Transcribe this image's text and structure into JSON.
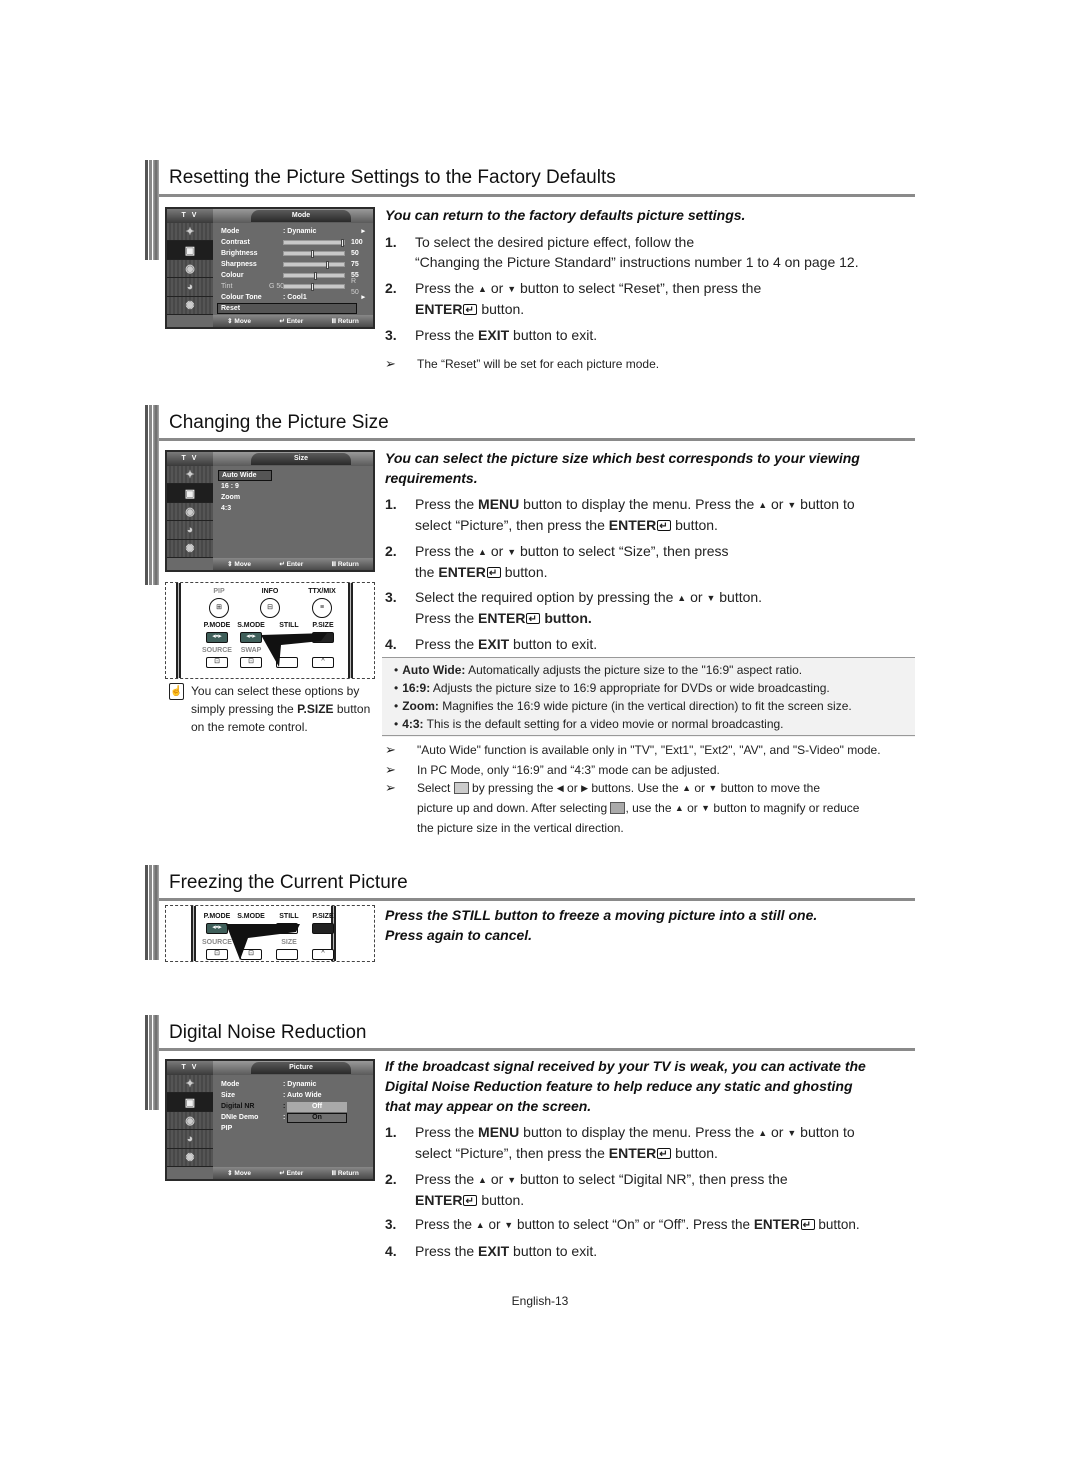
{
  "page": {
    "footer": "English-13"
  },
  "symbols": {
    "up": "▲",
    "down": "▼",
    "left": "◀",
    "right": "▶",
    "arrow_note": "➢"
  },
  "reset": {
    "title": "Resetting the Picture Settings to the Factory Defaults",
    "osd": {
      "tv": "T V",
      "tab": "Mode",
      "rows": [
        {
          "label": "Mode",
          "value": ": Dynamic",
          "arrow": "▸"
        },
        {
          "label": "Contrast",
          "slider": 100,
          "num": "100"
        },
        {
          "label": "Brightness",
          "slider": 50,
          "num": "50"
        },
        {
          "label": "Sharpness",
          "slider": 75,
          "num": "75"
        },
        {
          "label": "Colour",
          "slider": 55,
          "num": "55"
        },
        {
          "label": "Tint",
          "left": "G 50",
          "right": "R 50",
          "slider": 50
        },
        {
          "label": "Colour Tone",
          "value": ": Cool1",
          "arrow": "▸"
        },
        {
          "label": "Reset"
        }
      ],
      "footer": {
        "move": "⇕ Move",
        "enter": "↵ Enter",
        "return": "Ⅲ Return"
      }
    },
    "lead": "You can return to the factory defaults picture settings.",
    "steps": [
      {
        "num": "1.",
        "line1": "To select the desired picture effect, follow the",
        "line2": "“Changing the Picture Standard” instructions number 1 to 4 on page 12."
      },
      {
        "num": "2.",
        "pre": "Press the",
        "or": "or",
        "post": "button to select “Reset”, then press the",
        "enter": "ENTER",
        "tail": "button."
      },
      {
        "num": "3.",
        "pre": "Press the",
        "key": "EXIT",
        "post": "button to exit."
      }
    ],
    "note": "The “Reset” will be set for each picture mode."
  },
  "size": {
    "title": "Changing the Picture Size",
    "osd": {
      "tv": "T V",
      "tab": "Size",
      "options": [
        "Auto Wide",
        "16 : 9",
        "Zoom",
        "4:3"
      ],
      "selected": "Auto Wide",
      "footer": {
        "move": "⇕ Move",
        "enter": "↵ Enter",
        "return": "Ⅲ Return"
      }
    },
    "remote": {
      "row1": [
        "PIP",
        "INFO",
        "TTX/MIX"
      ],
      "row2": [
        "P.MODE",
        "S.MODE",
        "STILL",
        "P.SIZE"
      ],
      "row3": [
        "SOURCE",
        "SWAP"
      ]
    },
    "remote_note": {
      "pre": "You can select these options by simply pressing the",
      "key": "P.SIZE",
      "post": "button on the remote control."
    },
    "lead": "You can select the picture size which best corresponds to your viewing requirements.",
    "steps": [
      {
        "num": "1.",
        "pre": "Press the",
        "key": "MENU",
        "mid": "button to display the menu. Press the",
        "or": "or",
        "post": "button to",
        "line2_pre": "select “Picture”, then press the",
        "enter": "ENTER",
        "tail": "button."
      },
      {
        "num": "2.",
        "pre": "Press the",
        "or": "or",
        "post": "button to select “Size”, then press",
        "line2_pre": "the",
        "enter": "ENTER",
        "tail": "button."
      },
      {
        "num": "3.",
        "pre": "Select the required option by pressing the",
        "or": "or",
        "post": "button.",
        "line2_pre": "Press the",
        "enter": "ENTER",
        "tail": "button."
      },
      {
        "num": "4.",
        "pre": "Press the",
        "key": "EXIT",
        "post": "button to exit."
      }
    ],
    "bullets": [
      {
        "term": "Auto Wide:",
        "desc": "Automatically adjusts the picture size to the \"16:9\" aspect ratio."
      },
      {
        "term": "16:9:",
        "desc": "Adjusts the picture size to 16:9 appropriate for DVDs or wide broadcasting."
      },
      {
        "term": "Zoom:",
        "desc": "Magnifies the 16:9 wide picture (in the vertical direction) to fit the screen size."
      },
      {
        "term": "4:3:",
        "desc": "This is the default setting for a video movie or normal broadcasting."
      }
    ],
    "notes": [
      "\"Auto Wide\" function is available only in \"TV\", \"Ext1\", \"Ext2\", \"AV\", and \"S-Video\" mode.",
      "In PC Mode, only “16:9” and “4:3” mode can be adjusted.",
      {
        "a": "Select",
        "b": "by pressing the",
        "or": "or",
        "c": "buttons. Use the",
        "d": "button to move the",
        "line2a": "picture up and down.  After selecting",
        "line2b": ", use the",
        "line2c": "button to magnify or reduce",
        "line3": "the picture size in the vertical direction."
      }
    ]
  },
  "freeze": {
    "title": "Freezing the Current Picture",
    "remote": {
      "row1": [
        "P.MODE",
        "S.MODE",
        "STILL",
        "P.SIZE"
      ],
      "row2": [
        "SOURCE",
        "",
        "SIZE"
      ]
    },
    "lead_line1": "Press the STILL button to freeze a moving picture into a still one.",
    "lead_line2": "Press again to cancel."
  },
  "dnr": {
    "title": "Digital Noise Reduction",
    "osd": {
      "tv": "T V",
      "tab": "Picture",
      "rows": [
        {
          "label": "Mode",
          "value": ": Dynamic"
        },
        {
          "label": "Size",
          "value": ": Auto Wide"
        },
        {
          "label": "Digital NR",
          "value": ":"
        },
        {
          "label": "DNIe Demo",
          "value": ":"
        },
        {
          "label": "PIP"
        }
      ],
      "dropdown": [
        "Off",
        "On"
      ],
      "selected": "On",
      "footer": {
        "move": "⇕ Move",
        "enter": "↵ Enter",
        "return": "Ⅲ Return"
      }
    },
    "lead": [
      "If the broadcast signal received by your TV is weak, you can activate the",
      "Digital Noise Reduction feature to help reduce any static and ghosting",
      "that may appear on the screen."
    ],
    "steps": [
      {
        "num": "1.",
        "pre": "Press the",
        "key": "MENU",
        "mid": "button to display the menu. Press the",
        "or": "or",
        "post": "button to",
        "line2_pre": "select “Picture”, then press the",
        "enter": "ENTER",
        "tail": "button."
      },
      {
        "num": "2.",
        "pre": "Press the",
        "or": "or",
        "post": "button to select “Digital NR”, then press the",
        "enter": "ENTER",
        "tail": "button."
      },
      {
        "num": "3.",
        "pre": "Press the",
        "or": "or",
        "post": "button to select “On” or “Off”. Press the",
        "enter": "ENTER",
        "tail": "button."
      },
      {
        "num": "4.",
        "pre": "Press the",
        "key": "EXIT",
        "post": "button to exit."
      }
    ]
  }
}
